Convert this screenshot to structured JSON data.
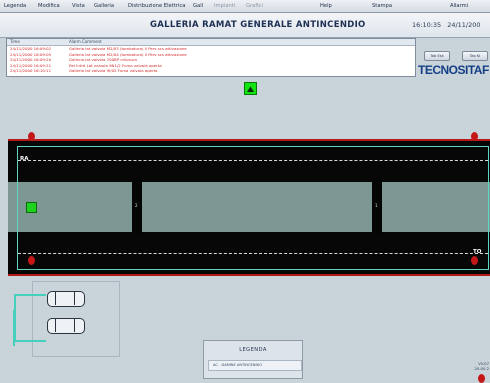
{
  "menu": {
    "items": [
      {
        "label": "Legenda",
        "dim": false
      },
      {
        "label": "Modifica",
        "dim": false
      },
      {
        "label": "Vista",
        "dim": false
      },
      {
        "label": "Galleria",
        "dim": false
      },
      {
        "label": "Distribuzione Elettrica",
        "dim": false
      },
      {
        "label": "Gall",
        "dim": false
      },
      {
        "label": "Impianti",
        "dim": true
      },
      {
        "label": "Grafici",
        "dim": true
      },
      {
        "label": "Help",
        "dim": false
      },
      {
        "label": "Stampa",
        "dim": false
      },
      {
        "label": "Allarmi",
        "dim": false
      }
    ]
  },
  "header": {
    "title": "GALLERIA RAMAT GENERALE ANTINCENDIO",
    "time": "16:10:35",
    "date": "24/11/200"
  },
  "alarms": {
    "col_time": "Time",
    "col_message": "Alarm Comment",
    "rows": [
      {
        "time": "24/11/2000 16:09:02",
        "message": "Galleria lat valvola M2/03 (tombatura) Il Pers scs attivazione"
      },
      {
        "time": "24/11/2000 16:09:05",
        "message": "Galleria lat valvola M2/04 (tombatura) Il Pers scs attivazione"
      },
      {
        "time": "24/11/2000 16:09:20",
        "message": "Galleria lat valvola 700BP chiusura"
      },
      {
        "time": "24/11/2000 16:09:21",
        "message": "Rel Intrd Lat valvola 9N1/2 Fuma valvola aperta"
      },
      {
        "time": "24/11/2000 16:10:11",
        "message": "Galleria lat valvola 9I/05 Fuma valvola aperta"
      }
    ]
  },
  "side_buttons": {
    "left": "Tab Esk",
    "right": "Tab Kl"
  },
  "logo": "TECNOSITAF",
  "tunnel": {
    "label_left": "RA",
    "label_right": "TO",
    "gate_1": "2",
    "gate_2": "1"
  },
  "legend": {
    "title": "LEGENDA",
    "entry": "AC - DAMINE ANTINCENDIO"
  },
  "corner": {
    "line1": "VV.07",
    "line2": "20.00.2"
  },
  "colors": {
    "alarm_text": "#d12a2a",
    "road": "#7d9893",
    "valve": "#c41818",
    "sensor": "#1ed21e",
    "logo": "#143f86"
  }
}
